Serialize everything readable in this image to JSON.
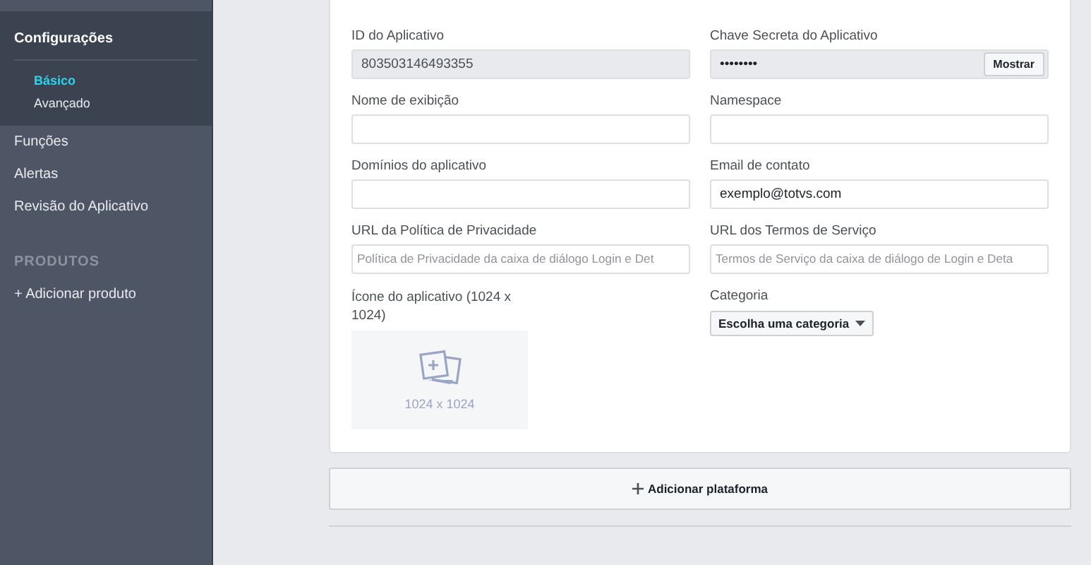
{
  "sidebar": {
    "items": [
      {
        "label": "Configurações",
        "selected": true,
        "expanded": true,
        "children": [
          {
            "label": "Básico",
            "selected": true
          },
          {
            "label": "Avançado",
            "selected": false
          }
        ]
      },
      {
        "label": "Funções",
        "selected": false
      },
      {
        "label": "Alertas",
        "selected": false
      },
      {
        "label": "Revisão do Aplicativo",
        "selected": false
      }
    ],
    "section_title": "PRODUTOS",
    "add_product": "+ Adicionar produto"
  },
  "form": {
    "fields": [
      {
        "kind": "readonly",
        "label": "ID do Aplicativo",
        "value": "803503146493355"
      },
      {
        "kind": "secret",
        "label": "Chave Secreta do Aplicativo",
        "value": "••••••••",
        "button": "Mostrar"
      },
      {
        "kind": "text",
        "label": "Nome de exibição"
      },
      {
        "kind": "text",
        "label": "Namespace"
      },
      {
        "kind": "text",
        "label": "Domínios do aplicativo"
      },
      {
        "kind": "text",
        "label": "Email de contato",
        "value": "exemplo@totvs.com"
      },
      {
        "kind": "text",
        "label": "URL da Política de Privacidade",
        "placeholder": "Política de Privacidade da caixa de diálogo Login e Det"
      },
      {
        "kind": "text",
        "label": "URL dos Termos de Serviço",
        "placeholder": "Termos de Serviço da caixa de diálogo de Login e Deta"
      },
      {
        "kind": "image",
        "label": "Ícone do aplicativo (1024 x 1024)",
        "caption": "1024 x 1024"
      },
      {
        "kind": "dropdown",
        "label": "Categoria",
        "value": "Escolha uma categoria"
      }
    ]
  },
  "add_platform_button": "Adicionar plataforma"
}
